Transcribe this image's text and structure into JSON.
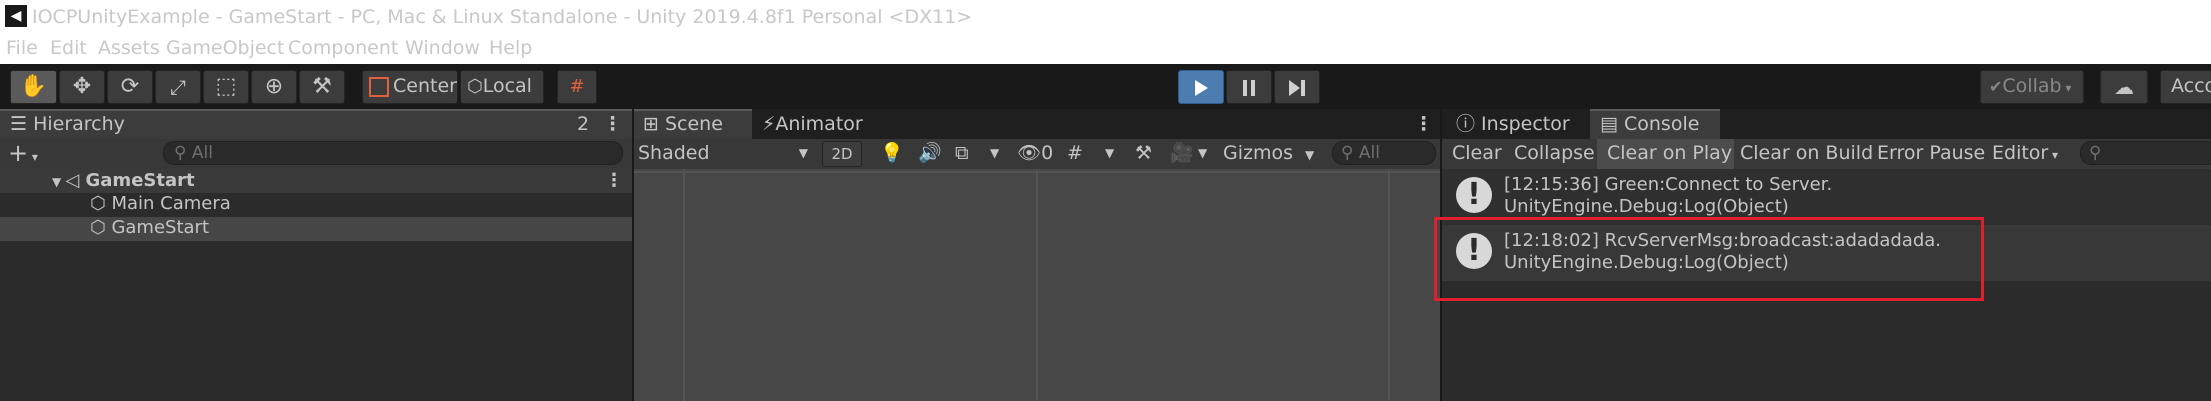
{
  "window": {
    "app_icon": "unity-logo-icon",
    "title": "IOCPUnityExample - GameStart - PC, Mac & Linux Standalone - Unity 2019.4.8f1 Personal <DX11>"
  },
  "menu": [
    "File",
    "Edit",
    "Assets",
    "GameObject",
    "Component",
    "Window",
    "Help"
  ],
  "toolbar": {
    "pivot_label": "Center",
    "space_label": "Local",
    "collab_label": "Collab",
    "account_label": "Acco"
  },
  "hierarchy": {
    "tab_label": "Hierarchy",
    "lock_count": "2",
    "search_placeholder": "All",
    "scene_name": "GameStart",
    "items": [
      "Main Camera",
      "GameStart"
    ]
  },
  "scene": {
    "tab_scene": "Scene",
    "tab_animator": "Animator",
    "shading_mode": "Shaded",
    "mode_2d": "2D",
    "hidden_count": "0",
    "gizmos_label": "Gizmos",
    "search_placeholder": "All"
  },
  "console": {
    "tab_inspector": "Inspector",
    "tab_console": "Console",
    "btn_clear": "Clear",
    "btn_collapse": "Collapse",
    "btn_clear_on_play": "Clear on Play",
    "btn_clear_on_build": "Clear on Build",
    "btn_error_pause": "Error Pause",
    "btn_editor": "Editor",
    "entries": [
      {
        "line1": "[12:15:36] Green:Connect to Server.",
        "line2": "UnityEngine.Debug:Log(Object)"
      },
      {
        "line1": "[12:18:02] RcvServerMsg:broadcast:adadadada.",
        "line2": "UnityEngine.Debug:Log(Object)"
      }
    ],
    "highlight_color": "#e0202e"
  }
}
